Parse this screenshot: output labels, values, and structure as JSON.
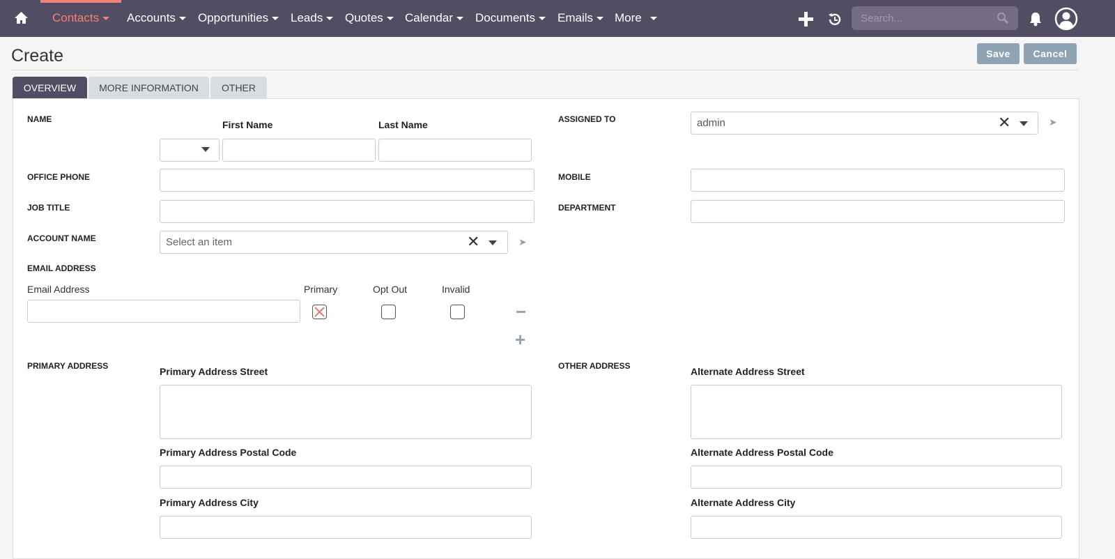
{
  "nav": {
    "items": [
      "Contacts",
      "Accounts",
      "Opportunities",
      "Leads",
      "Quotes",
      "Calendar",
      "Documents",
      "Emails",
      "More"
    ],
    "active": "Contacts",
    "search_placeholder": "Search..."
  },
  "colors": {
    "nav_bg": "#534d64",
    "accent": "#f08377",
    "button": "#8fa3b3"
  },
  "page": {
    "title": "Create",
    "save": "Save",
    "cancel": "Cancel"
  },
  "tabs": [
    "OVERVIEW",
    "MORE INFORMATION",
    "OTHER"
  ],
  "form": {
    "name": "NAME",
    "first_name": "First Name",
    "last_name": "Last Name",
    "assigned_to": "ASSIGNED TO",
    "assigned_value": "admin",
    "office_phone": "OFFICE PHONE",
    "mobile": "MOBILE",
    "job_title": "JOB TITLE",
    "department": "DEPARTMENT",
    "account_name": "ACCOUNT NAME",
    "account_placeholder": "Select an item",
    "email_address": "EMAIL ADDRESS",
    "email_col": "Email Address",
    "primary": "Primary",
    "opt_out": "Opt Out",
    "invalid": "Invalid",
    "primary_address": "PRIMARY ADDRESS",
    "other_address": "OTHER ADDRESS",
    "pa_street": "Primary Address Street",
    "pa_postal": "Primary Address Postal Code",
    "pa_city": "Primary Address City",
    "aa_street": "Alternate Address Street",
    "aa_postal": "Alternate Address Postal Code",
    "aa_city": "Alternate Address City"
  }
}
